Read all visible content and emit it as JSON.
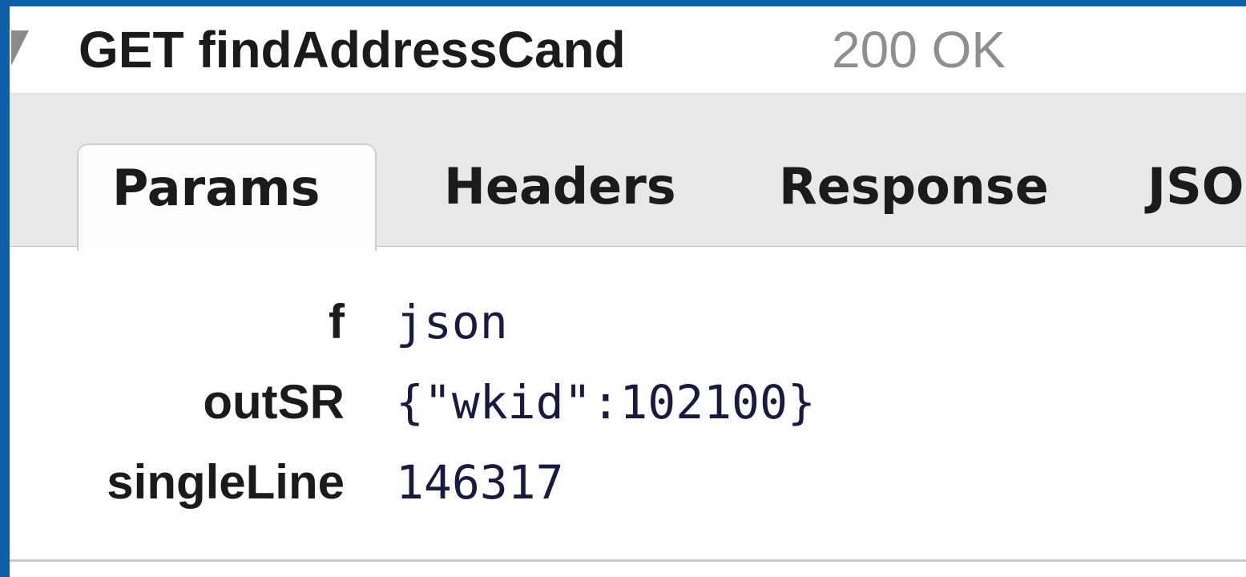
{
  "request": {
    "method_and_name": "GET findAddressCand",
    "status": "200 OK"
  },
  "tabs": [
    {
      "label": "Params",
      "active": true
    },
    {
      "label": "Headers",
      "active": false
    },
    {
      "label": "Response",
      "active": false
    },
    {
      "label": "JSON",
      "active": false
    }
  ],
  "params": [
    {
      "name": "f",
      "value": "json"
    },
    {
      "name": "outSR",
      "value": "{\"wkid\":102100}"
    },
    {
      "name": "singleLine",
      "value": "146317"
    }
  ],
  "colors": {
    "window_border": "#0d5fa8",
    "status_text": "#8f8f8f",
    "tab_bar_bg": "#e8e8e8"
  },
  "icons": {
    "expand_toggle": "triangle-down-icon"
  }
}
